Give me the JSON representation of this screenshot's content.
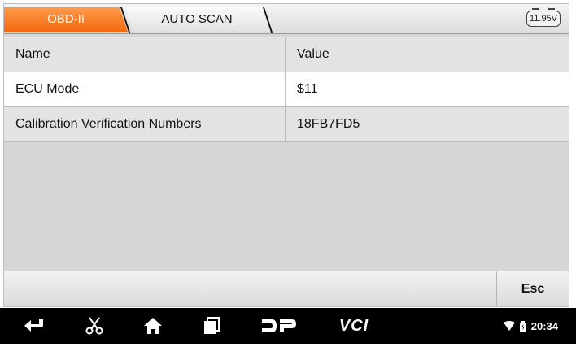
{
  "tabs": [
    {
      "label": "OBD-II",
      "active": true
    },
    {
      "label": "AUTO SCAN",
      "active": false
    }
  ],
  "battery": {
    "voltage": "11.95V"
  },
  "table": {
    "headers": [
      "Name",
      "Value"
    ],
    "rows": [
      [
        "ECU Mode",
        "$11"
      ],
      [
        "Calibration Verification Numbers",
        "18FB7FD5"
      ]
    ]
  },
  "actions": {
    "esc_label": "Esc"
  },
  "navbar": {
    "icons": [
      "back-icon",
      "scissors-icon",
      "home-icon",
      "recent-apps-icon",
      "dp-logo-icon",
      "vci-logo-icon"
    ],
    "vci_label": "VCI",
    "time": "20:34"
  },
  "colors": {
    "accent": "#f26a10",
    "navbar": "#000000"
  }
}
